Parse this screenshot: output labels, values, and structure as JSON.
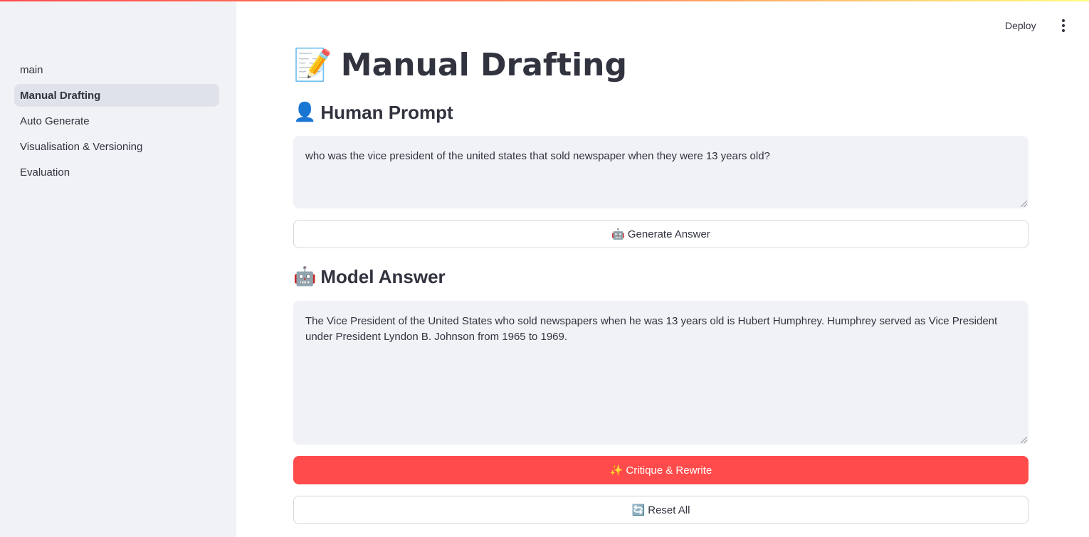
{
  "sidebar": {
    "items": [
      {
        "label": "main",
        "active": false
      },
      {
        "label": "Manual Drafting",
        "active": true
      },
      {
        "label": "Auto Generate",
        "active": false
      },
      {
        "label": "Visualisation & Versioning",
        "active": false
      },
      {
        "label": "Evaluation",
        "active": false
      }
    ]
  },
  "header": {
    "deploy_label": "Deploy",
    "menu_icon": "kebab-menu-icon"
  },
  "page": {
    "title_icon": "📝",
    "title": "Manual Drafting"
  },
  "human_prompt": {
    "icon": "👤",
    "heading": "Human Prompt",
    "value": "who was the vice president of the united states that sold newspaper when they were 13 years old?"
  },
  "generate": {
    "icon": "🤖",
    "label": "Generate Answer"
  },
  "model_answer": {
    "icon": "🤖",
    "heading": "Model Answer",
    "value": "The Vice President of the United States who sold newspapers when he was 13 years old is Hubert Humphrey. Humphrey served as Vice President under President Lyndon B. Johnson from 1965 to 1969."
  },
  "critique": {
    "icon": "✨",
    "label": "Critique & Rewrite"
  },
  "reset": {
    "icon": "🔄",
    "label": "Reset All"
  },
  "colors": {
    "accent": "#ff4b4b",
    "sidebar_bg": "#f0f2f6",
    "active_item_bg": "#dfe2ea"
  }
}
